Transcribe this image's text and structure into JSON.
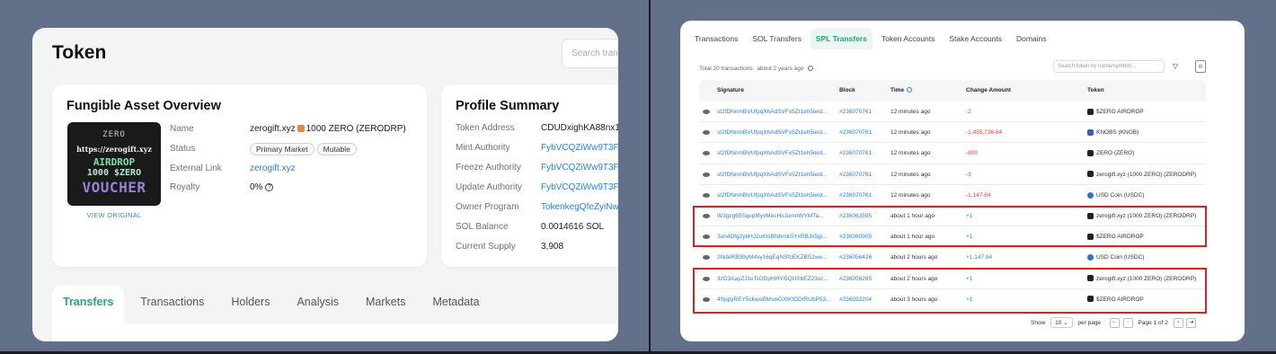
{
  "left": {
    "title": "Token",
    "search_placeholder": "Search trans",
    "fungible": {
      "title": "Fungible Asset Overview",
      "image": {
        "line1": "ZERO",
        "line2": "https://zerogift.xyz",
        "line3": "AIRDROP",
        "line4": "1000 $ZERO",
        "line5": "VOUCHER"
      },
      "view_original": "VIEW ORIGINAL",
      "name_label": "Name",
      "name_value_a": "zerogift.xyz",
      "name_value_b": "1000 ZERO (ZERODRP)",
      "status_label": "Status",
      "status_tag1": "Primary Market",
      "status_tag2": "Mutable",
      "external_link_label": "External Link",
      "external_link_value": "zerogift.xyz",
      "royalty_label": "Royalty",
      "royalty_value": "0%"
    },
    "profile": {
      "title": "Profile Summary",
      "rows": [
        {
          "label": "Token Address",
          "value": "CDUDxighKA88nx1"
        },
        {
          "label": "Mint Authority",
          "value": "FybVCQZiWw9T3Fu"
        },
        {
          "label": "Freeze Authority",
          "value": "FybVCQZiWw9T3Fu"
        },
        {
          "label": "Update Authority",
          "value": "FybVCQZiWw9T3Fu"
        },
        {
          "label": "Owner Program",
          "value": "TokenkegQfeZyiNw"
        },
        {
          "label": "SOL Balance",
          "value": "0.0014616 SOL"
        },
        {
          "label": "Current Supply",
          "value": "3,908"
        }
      ]
    },
    "tabs": [
      "Transfers",
      "Transactions",
      "Holders",
      "Analysis",
      "Markets",
      "Metadata"
    ]
  },
  "right": {
    "tabs": [
      "Transactions",
      "SOL Transfers",
      "SPL Transfers",
      "Token Accounts",
      "Stake Accounts",
      "Domains"
    ],
    "total_text": "Total 20 transactions",
    "total_time": "about 2 years ago",
    "search_placeholder": "Search token by name/symbol/...",
    "columns": [
      "Signature",
      "Block",
      "Time",
      "Change Amount",
      "Token"
    ],
    "rows": [
      {
        "sig": "st2fDNnmBVUfpqXhAdSVFx5Zt1eh5ieid...",
        "block": "#236070761",
        "time": "12 minutes ago",
        "change": "-2",
        "token": "$ZERO AIRDROP"
      },
      {
        "sig": "st2fDNnmBVUfpqXhAdSVFx5Zt1eh5ieid...",
        "block": "#236070761",
        "time": "12 minutes ago",
        "change": "-1,455,736.64",
        "token": "KNOBS (KNOB)"
      },
      {
        "sig": "st2fDNnmBVUfpqXhAdSVFx5Zt1eh5ieid...",
        "block": "#236070761",
        "time": "12 minutes ago",
        "change": "-800",
        "token": "ZERO (ZERO)"
      },
      {
        "sig": "st2fDNnmBVUfpqXhAdSVFx5Zt1eh5ieid...",
        "block": "#236070761",
        "time": "12 minutes ago",
        "change": "-3",
        "token": "zerogift.xyz (1000 ZERO) (ZERODRP)"
      },
      {
        "sig": "st2fDNnmBVUfpqXhAdSVFx5Zt1eh5ieid...",
        "block": "#236070761",
        "time": "12 minutes ago",
        "change": "-1,147.84",
        "token": "USD Coin (USDC)"
      },
      {
        "sig": "W3gzg65SqvpMyvMecHxJumnWYMTa...",
        "block": "#236063595",
        "time": "about 1 hour ago",
        "change": "+1",
        "token": "zerogift.xyz (1000 ZERO) (ZERODRP)"
      },
      {
        "sig": "3uh4Dfg2ybHJ2uKtsBNbmkSYxRBJv5gi...",
        "block": "#236060905",
        "time": "about 1 hour ago",
        "change": "+1",
        "token": "$ZERO AIRDROP"
      },
      {
        "sig": "2NdeRB99yM4vy16qEqNSfoEKZBS2we...",
        "block": "#236056426",
        "time": "about 2 hours ago",
        "change": "+1,147.84",
        "token": "USD Coin (USDC)"
      },
      {
        "sig": "3zD3AayZJzuTcDDpHHYi5QUXbEZ23sc...",
        "block": "#236056265",
        "time": "about 2 hours ago",
        "change": "+1",
        "token": "zerogift.xyz (1000 ZERO) (ZERODRP)"
      },
      {
        "sig": "4SppyREY5ckwoBMswGXtKtDDfRUbP53...",
        "block": "#236052204",
        "time": "about 3 hours ago",
        "change": "+1",
        "token": "$ZERO AIRDROP"
      }
    ],
    "pagination": {
      "show": "Show",
      "per_page_value": "10",
      "per_page": "per page",
      "page_text": "Page 1 of 2"
    }
  },
  "colors": {
    "accent": "#1aa87f",
    "link": "#2d7fd3",
    "negative": "#e04040",
    "highlight": "#e02020"
  }
}
